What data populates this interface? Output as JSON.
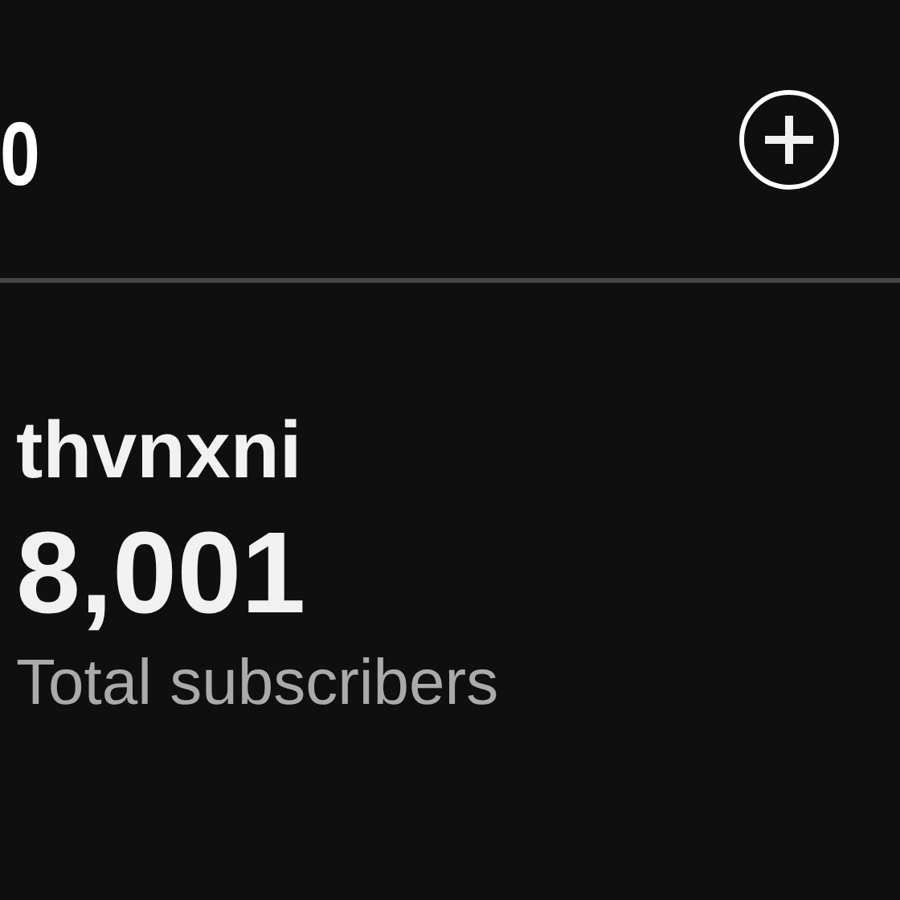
{
  "header": {
    "title": "0"
  },
  "channel": {
    "name": "thvnxni",
    "subscriber_count": "8,001",
    "subscriber_label": "Total subscribers"
  }
}
